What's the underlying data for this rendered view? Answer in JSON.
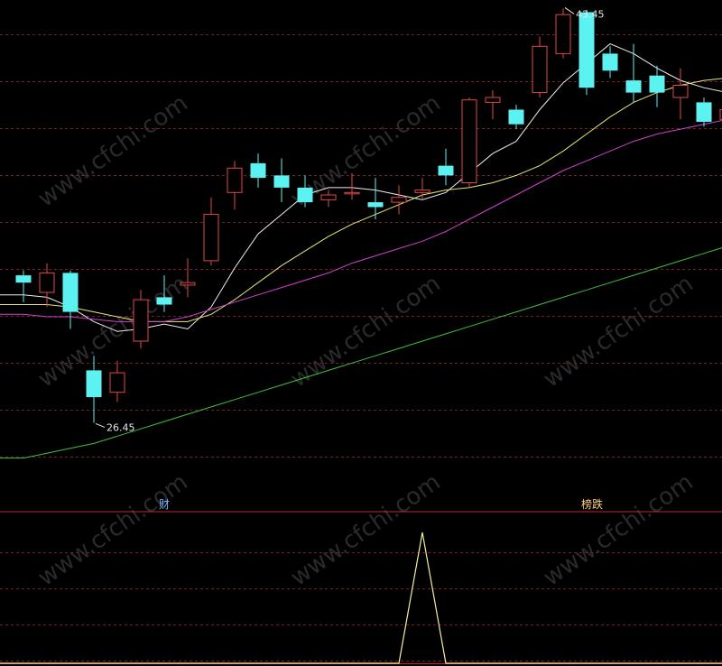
{
  "watermark": "www.cfchi.com",
  "colors": {
    "background": "#000000",
    "grid": "#7a1f1f",
    "separator": "#c0282c",
    "up_candle": "#e04848",
    "down_candle": "#5cf2f2",
    "ma5": "#f0f0f0",
    "ma10": "#e8e878",
    "ma20": "#d040d0",
    "ma60": "#40c040",
    "signal_line": "#f4f0a0",
    "tag_cai": "#7ab6ff",
    "tag_bangdie": "#ffd080",
    "label": "#e8e8e8"
  },
  "markers": {
    "high_label": "43.45",
    "low_label": "26.45"
  },
  "signal_tags": [
    {
      "text": "财",
      "candle_index": 6
    },
    {
      "text": "榜跌",
      "candle_index": 24
    }
  ],
  "chart_data": [
    {
      "type": "candlestick",
      "yrange": [
        23.8,
        43.8
      ],
      "candles": [
        {
          "o": 32.5,
          "h": 32.7,
          "l": 31.4,
          "c": 32.2
        },
        {
          "o": 31.8,
          "h": 33.0,
          "l": 31.2,
          "c": 32.6
        },
        {
          "o": 32.6,
          "h": 32.7,
          "l": 30.3,
          "c": 31.0
        },
        {
          "o": 28.6,
          "h": 29.2,
          "l": 26.45,
          "c": 27.5
        },
        {
          "o": 27.7,
          "h": 29.0,
          "l": 27.3,
          "c": 28.5
        },
        {
          "o": 29.8,
          "h": 31.9,
          "l": 29.5,
          "c": 31.5
        },
        {
          "o": 31.6,
          "h": 32.5,
          "l": 31.0,
          "c": 31.3
        },
        {
          "o": 32.1,
          "h": 33.2,
          "l": 31.6,
          "c": 32.2
        },
        {
          "o": 33.1,
          "h": 35.7,
          "l": 32.9,
          "c": 35.0
        },
        {
          "o": 35.9,
          "h": 37.2,
          "l": 35.2,
          "c": 36.9
        },
        {
          "o": 37.1,
          "h": 37.5,
          "l": 36.1,
          "c": 36.5
        },
        {
          "o": 36.6,
          "h": 37.3,
          "l": 35.5,
          "c": 36.1
        },
        {
          "o": 36.1,
          "h": 36.6,
          "l": 35.3,
          "c": 35.5
        },
        {
          "o": 35.6,
          "h": 36.0,
          "l": 35.3,
          "c": 35.8
        },
        {
          "o": 35.9,
          "h": 36.7,
          "l": 35.6,
          "c": 35.9
        },
        {
          "o": 35.5,
          "h": 36.5,
          "l": 34.8,
          "c": 35.3
        },
        {
          "o": 35.5,
          "h": 36.2,
          "l": 35.0,
          "c": 35.7
        },
        {
          "o": 35.9,
          "h": 36.5,
          "l": 35.6,
          "c": 36.0
        },
        {
          "o": 37.0,
          "h": 37.7,
          "l": 36.2,
          "c": 36.6
        },
        {
          "o": 36.3,
          "h": 39.8,
          "l": 36.1,
          "c": 39.7
        },
        {
          "o": 39.6,
          "h": 40.1,
          "l": 38.9,
          "c": 39.8
        },
        {
          "o": 39.3,
          "h": 39.5,
          "l": 38.5,
          "c": 38.7
        },
        {
          "o": 40.0,
          "h": 42.3,
          "l": 39.8,
          "c": 41.9
        },
        {
          "o": 41.6,
          "h": 43.45,
          "l": 41.4,
          "c": 43.2
        },
        {
          "o": 43.3,
          "h": 43.4,
          "l": 39.9,
          "c": 40.2
        },
        {
          "o": 41.6,
          "h": 41.9,
          "l": 40.6,
          "c": 40.9
        },
        {
          "o": 40.5,
          "h": 42.0,
          "l": 39.6,
          "c": 40.0
        },
        {
          "o": 40.7,
          "h": 41.1,
          "l": 39.4,
          "c": 40.0
        },
        {
          "o": 39.8,
          "h": 41.0,
          "l": 38.9,
          "c": 40.3
        },
        {
          "o": 39.6,
          "h": 39.8,
          "l": 38.6,
          "c": 38.8
        },
        {
          "o": 38.9,
          "h": 40.1,
          "l": 38.5,
          "c": 39.3
        }
      ],
      "ma_series": [
        {
          "key": "ma5",
          "values": [
            31.7,
            31.6,
            31.2,
            30.6,
            30.2,
            30.3,
            30.5,
            30.3,
            31.2,
            32.8,
            34.2,
            35.0,
            35.8,
            36.1,
            36.1,
            36.0,
            35.8,
            35.6,
            35.9,
            36.7,
            37.5,
            38.0,
            39.3,
            40.4,
            41.2,
            42.0,
            41.6,
            41.0,
            40.5,
            40.2,
            40.0
          ]
        },
        {
          "key": "ma10",
          "values": [
            31.3,
            31.3,
            31.2,
            31.0,
            30.8,
            30.6,
            30.6,
            30.6,
            30.9,
            31.5,
            32.2,
            32.9,
            33.5,
            34.1,
            34.6,
            35.0,
            35.4,
            35.8,
            36.0,
            36.1,
            36.3,
            36.6,
            37.0,
            37.6,
            38.3,
            39.0,
            39.6,
            40.0,
            40.3,
            40.5,
            40.6
          ]
        },
        {
          "key": "ma20",
          "values": [
            30.9,
            30.8,
            30.8,
            30.7,
            30.6,
            30.6,
            30.6,
            30.8,
            31.1,
            31.4,
            31.7,
            32.0,
            32.3,
            32.6,
            33.0,
            33.3,
            33.6,
            33.9,
            34.3,
            34.8,
            35.3,
            35.8,
            36.3,
            36.8,
            37.2,
            37.6,
            38.0,
            38.3,
            38.5,
            38.7,
            38.9
          ]
        },
        {
          "key": "ma60",
          "values": [
            25.0,
            25.2,
            25.4,
            25.6,
            25.9,
            26.2,
            26.5,
            26.8,
            27.1,
            27.4,
            27.7,
            28.0,
            28.3,
            28.6,
            28.9,
            29.2,
            29.5,
            29.8,
            30.1,
            30.4,
            30.7,
            31.0,
            31.3,
            31.6,
            31.9,
            32.2,
            32.5,
            32.8,
            33.1,
            33.4,
            33.7
          ]
        }
      ]
    },
    {
      "type": "line",
      "yrange": [
        0,
        1
      ],
      "values": [
        0,
        0,
        0,
        0,
        0,
        0,
        0,
        0,
        0,
        0,
        0,
        0,
        0,
        0,
        0,
        0,
        0,
        1,
        0,
        0,
        0,
        0,
        0,
        0,
        0,
        0,
        0,
        0,
        0,
        0,
        0
      ]
    }
  ]
}
